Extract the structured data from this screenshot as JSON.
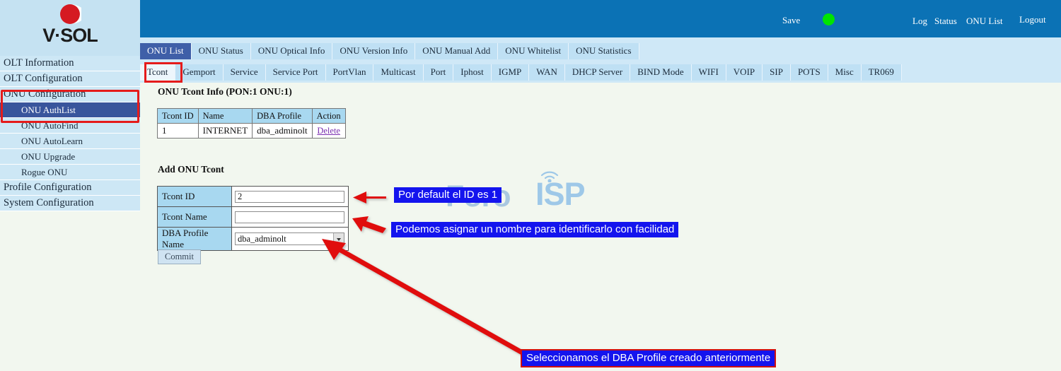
{
  "brand": {
    "logo_text": "V·SOL",
    "logo_icon": "vsol-sphere-logo"
  },
  "sidebar": {
    "items": [
      {
        "label": "OLT Information",
        "level": "top",
        "active": false
      },
      {
        "label": "OLT Configuration",
        "level": "top",
        "active": false
      },
      {
        "label": "ONU Configuration",
        "level": "top",
        "active": false
      },
      {
        "label": "ONU AuthList",
        "level": "sub",
        "active": true
      },
      {
        "label": "ONU AutoFind",
        "level": "sub",
        "active": false
      },
      {
        "label": "ONU AutoLearn",
        "level": "sub",
        "active": false
      },
      {
        "label": "ONU Upgrade",
        "level": "sub",
        "active": false
      },
      {
        "label": "Rogue ONU",
        "level": "sub",
        "active": false
      },
      {
        "label": "Profile Configuration",
        "level": "top",
        "active": false
      },
      {
        "label": "System Configuration",
        "level": "top",
        "active": false
      }
    ]
  },
  "header": {
    "save_label": "Save",
    "status_indicator": "green-status-dot",
    "status_color": "#00e400",
    "log_label": "Log",
    "status_label": "Status",
    "onu_list_label": "ONU List",
    "logout_label": "Logout",
    "background_color": "#0b72b5"
  },
  "tabs_primary": [
    {
      "label": "ONU List",
      "active": true
    },
    {
      "label": "ONU Status",
      "active": false
    },
    {
      "label": "ONU Optical Info",
      "active": false
    },
    {
      "label": "ONU Version Info",
      "active": false
    },
    {
      "label": "ONU Manual Add",
      "active": false
    },
    {
      "label": "ONU Whitelist",
      "active": false
    },
    {
      "label": "ONU Statistics",
      "active": false
    }
  ],
  "tabs_secondary": [
    {
      "label": "Tcont",
      "active": true
    },
    {
      "label": "Gemport",
      "active": false
    },
    {
      "label": "Service",
      "active": false
    },
    {
      "label": "Service Port",
      "active": false
    },
    {
      "label": "PortVlan",
      "active": false
    },
    {
      "label": "Multicast",
      "active": false
    },
    {
      "label": "Port",
      "active": false
    },
    {
      "label": "Iphost",
      "active": false
    },
    {
      "label": "IGMP",
      "active": false
    },
    {
      "label": "WAN",
      "active": false
    },
    {
      "label": "DHCP Server",
      "active": false
    },
    {
      "label": "BIND Mode",
      "active": false
    },
    {
      "label": "WIFI",
      "active": false
    },
    {
      "label": "VOIP",
      "active": false
    },
    {
      "label": "SIP",
      "active": false
    },
    {
      "label": "POTS",
      "active": false
    },
    {
      "label": "Misc",
      "active": false
    },
    {
      "label": "TR069",
      "active": false
    }
  ],
  "main": {
    "info_title": "ONU Tcont Info (PON:1 ONU:1)",
    "info_table": {
      "headers": [
        "Tcont ID",
        "Name",
        "DBA Profile",
        "Action"
      ],
      "rows": [
        [
          "1",
          "INTERNET",
          "dba_adminolt",
          "Delete"
        ]
      ]
    },
    "add_title": "Add ONU Tcont",
    "form": {
      "tcont_id_label": "Tcont ID",
      "tcont_id_value": "2",
      "tcont_name_label": "Tcont Name",
      "tcont_name_value": "",
      "tcont_name_placeholder": "",
      "dba_profile_label": "DBA Profile Name",
      "dba_profile_value": "dba_adminolt",
      "commit_label": "Commit"
    }
  },
  "watermark": {
    "part1": "Foro",
    "part2": "ISP",
    "icon": "wifi-antenna-icon"
  },
  "annotations": {
    "callout_1": "Por default el ID es 1",
    "callout_2": "Podemos asignar un nombre para identificarlo con facilidad",
    "callout_3": "Seleccionamos el DBA Profile creado anteriormente",
    "highlight_color": "#e51b1b",
    "callout_bg": "#1414ee"
  }
}
